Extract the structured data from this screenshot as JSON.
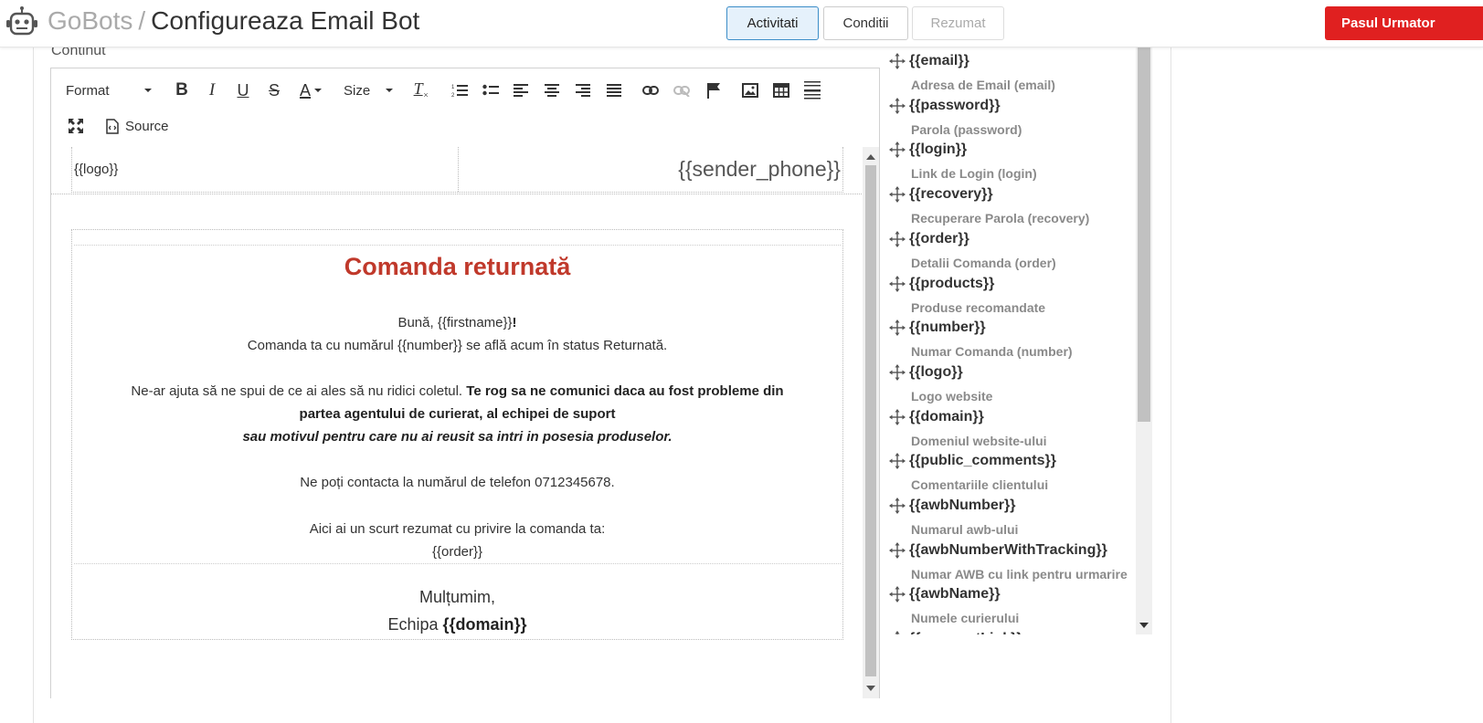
{
  "header": {
    "brand": "GoBots",
    "separator": "/",
    "title": "Configureaza Email Bot",
    "steps": [
      {
        "label": "Activitati",
        "state": "active"
      },
      {
        "label": "Conditii",
        "state": "normal"
      },
      {
        "label": "Rezumat",
        "state": "disabled"
      }
    ],
    "next_label": "Pasul Urmator",
    "next_color": "#e02020",
    "active_color": "#3c8dc8"
  },
  "content_label": "Continut",
  "toolbar": {
    "format_label": "Format",
    "size_label": "Size",
    "source_label": "Source"
  },
  "email": {
    "logo_placeholder": "{{logo}}",
    "sender_phone": "{{sender_phone}}",
    "heading": "Comanda returnată",
    "heading_color": "#c0392b",
    "greeting_prefix": "Bună, {{firstname}}",
    "greeting_suffix": "!",
    "line1": "Comanda ta cu numărul {{number}} se află acum în status Returnată.",
    "line2_normal": "Ne-ar ajuta să ne spui de ce ai ales să nu ridici coletul.",
    "line2_bold": "Te rog sa ne comunici daca au fost probleme din",
    "line3_bold": "partea agentului de curierat, al echipei de suport",
    "line4_italic": "sau motivul pentru care nu ai reusit sa intri in posesia produselor.",
    "line5": "Ne poți contacta la numărul de telefon 0712345678.",
    "line6": "Aici ai un scurt rezumat cu privire la comanda ta:",
    "line7": "{{order}}",
    "thanks": "Mulțumim,",
    "team_prefix": "Echipa",
    "team_domain": "{{domain}}"
  },
  "placeholders": [
    {
      "code": "{{email}}",
      "desc": "Adresa de Email (email)"
    },
    {
      "code": "{{password}}",
      "desc": "Parola (password)"
    },
    {
      "code": "{{login}}",
      "desc": "Link de Login (login)"
    },
    {
      "code": "{{recovery}}",
      "desc": "Recuperare Parola (recovery)"
    },
    {
      "code": "{{order}}",
      "desc": "Detalii Comanda (order)"
    },
    {
      "code": "{{products}}",
      "desc": "Produse recomandate"
    },
    {
      "code": "{{number}}",
      "desc": "Numar Comanda (number)"
    },
    {
      "code": "{{logo}}",
      "desc": "Logo website"
    },
    {
      "code": "{{domain}}",
      "desc": "Domeniul website-ului"
    },
    {
      "code": "{{public_comments}}",
      "desc": "Comentariile clientului"
    },
    {
      "code": "{{awbNumber}}",
      "desc": "Numarul awb-ului"
    },
    {
      "code": "{{awbNumberWithTracking}}",
      "desc": "Numar AWB cu link pentru urmarire"
    },
    {
      "code": "{{awbName}}",
      "desc": "Numele curierului"
    },
    {
      "code": "{{paymentLink}}",
      "desc": ""
    }
  ]
}
